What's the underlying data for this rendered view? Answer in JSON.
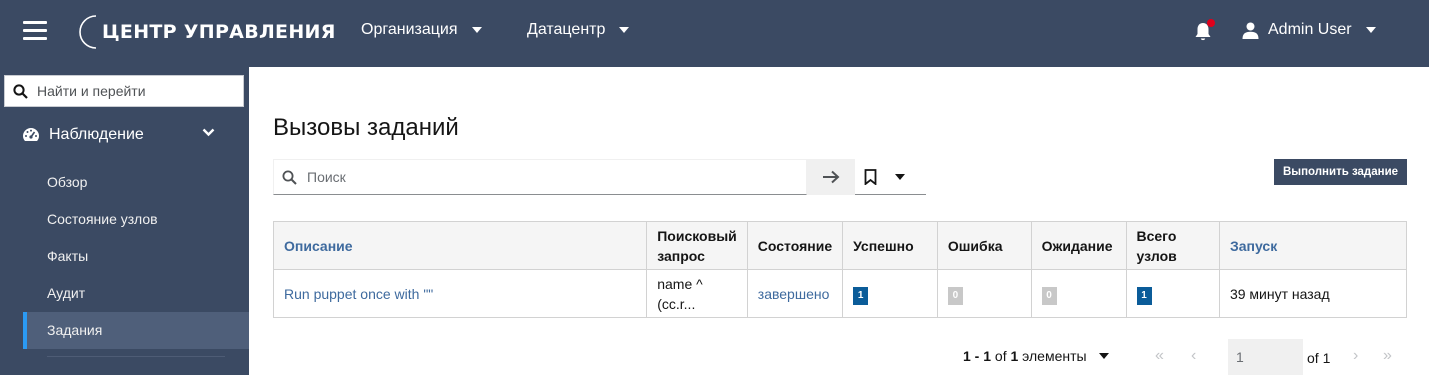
{
  "topbar": {
    "brand": "ЦЕНТР УПРАВЛЕНИЯ",
    "org_label": "Организация",
    "dc_label": "Датацентр",
    "user_name": "Admin User"
  },
  "sidebar": {
    "search_placeholder": "Найти и перейти",
    "section_label": "Наблюдение",
    "items": [
      {
        "label": "Обзор"
      },
      {
        "label": "Состояние узлов"
      },
      {
        "label": "Факты"
      },
      {
        "label": "Аудит"
      },
      {
        "label": "Задания"
      }
    ]
  },
  "main": {
    "title": "Вызовы заданий",
    "search_placeholder": "Поиск",
    "run_button": "Выполнить задание"
  },
  "table": {
    "headers": {
      "description": "Описание",
      "search_query_1": "Поисковый",
      "search_query_2": "запрос",
      "state": "Состояние",
      "success": "Успешно",
      "error": "Ошибка",
      "pending": "Ожидание",
      "total_1": "Всего",
      "total_2": "узлов",
      "started": "Запуск"
    },
    "rows": [
      {
        "description": "Run puppet once with \"\"",
        "query_1": "name ^",
        "query_2": "(cc.r...",
        "state": "завершено",
        "success": "1",
        "error": "0",
        "pending": "0",
        "total": "1",
        "started": "39 минут назад"
      }
    ]
  },
  "pagination": {
    "range": "1 - 1",
    "of_word": "of",
    "total": "1",
    "unit": "элементы",
    "page": "1",
    "of_pages": "of 1"
  },
  "colors": {
    "header_bg": "#3b4a63",
    "link": "#3e6a9e",
    "badge_blue": "#0b5c99",
    "badge_grey": "#c8c8c8",
    "active_accent": "#2b9af3"
  }
}
